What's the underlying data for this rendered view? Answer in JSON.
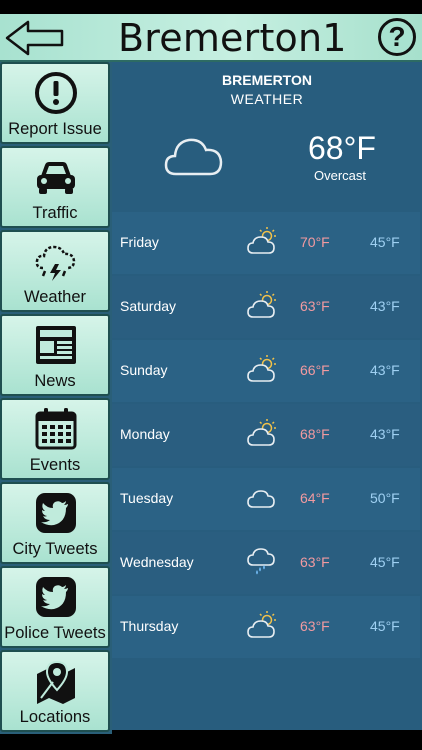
{
  "header": {
    "title": "Bremerton1",
    "help_label": "?"
  },
  "sidebar": {
    "items": [
      {
        "label": "Report Issue",
        "icon": "alert-icon"
      },
      {
        "label": "Traffic",
        "icon": "car-icon"
      },
      {
        "label": "Weather",
        "icon": "storm-cloud-icon"
      },
      {
        "label": "News",
        "icon": "newspaper-icon"
      },
      {
        "label": "Events",
        "icon": "calendar-icon"
      },
      {
        "label": "City Tweets",
        "icon": "twitter-icon"
      },
      {
        "label": "Police Tweets",
        "icon": "twitter-icon"
      },
      {
        "label": "Locations",
        "icon": "map-pin-icon"
      }
    ]
  },
  "weather": {
    "city": "BREMERTON",
    "subtitle": "WEATHER",
    "current_temp": "68°F",
    "current_condition": "Overcast",
    "forecast": [
      {
        "day": "Friday",
        "high": "70°F",
        "low": "45°F",
        "icon": "partly-cloudy-icon"
      },
      {
        "day": "Saturday",
        "high": "63°F",
        "low": "43°F",
        "icon": "partly-cloudy-icon"
      },
      {
        "day": "Sunday",
        "high": "66°F",
        "low": "43°F",
        "icon": "partly-cloudy-icon"
      },
      {
        "day": "Monday",
        "high": "68°F",
        "low": "43°F",
        "icon": "partly-cloudy-icon"
      },
      {
        "day": "Tuesday",
        "high": "64°F",
        "low": "50°F",
        "icon": "cloud-icon"
      },
      {
        "day": "Wednesday",
        "high": "63°F",
        "low": "45°F",
        "icon": "rain-cloud-icon"
      },
      {
        "day": "Thursday",
        "high": "63°F",
        "low": "45°F",
        "icon": "partly-cloudy-icon"
      }
    ]
  },
  "colors": {
    "header_bg": "#a8e2d0",
    "panel_bg": "#285d7e",
    "high_temp": "#f29aa0",
    "low_temp": "#9fd0f2"
  }
}
